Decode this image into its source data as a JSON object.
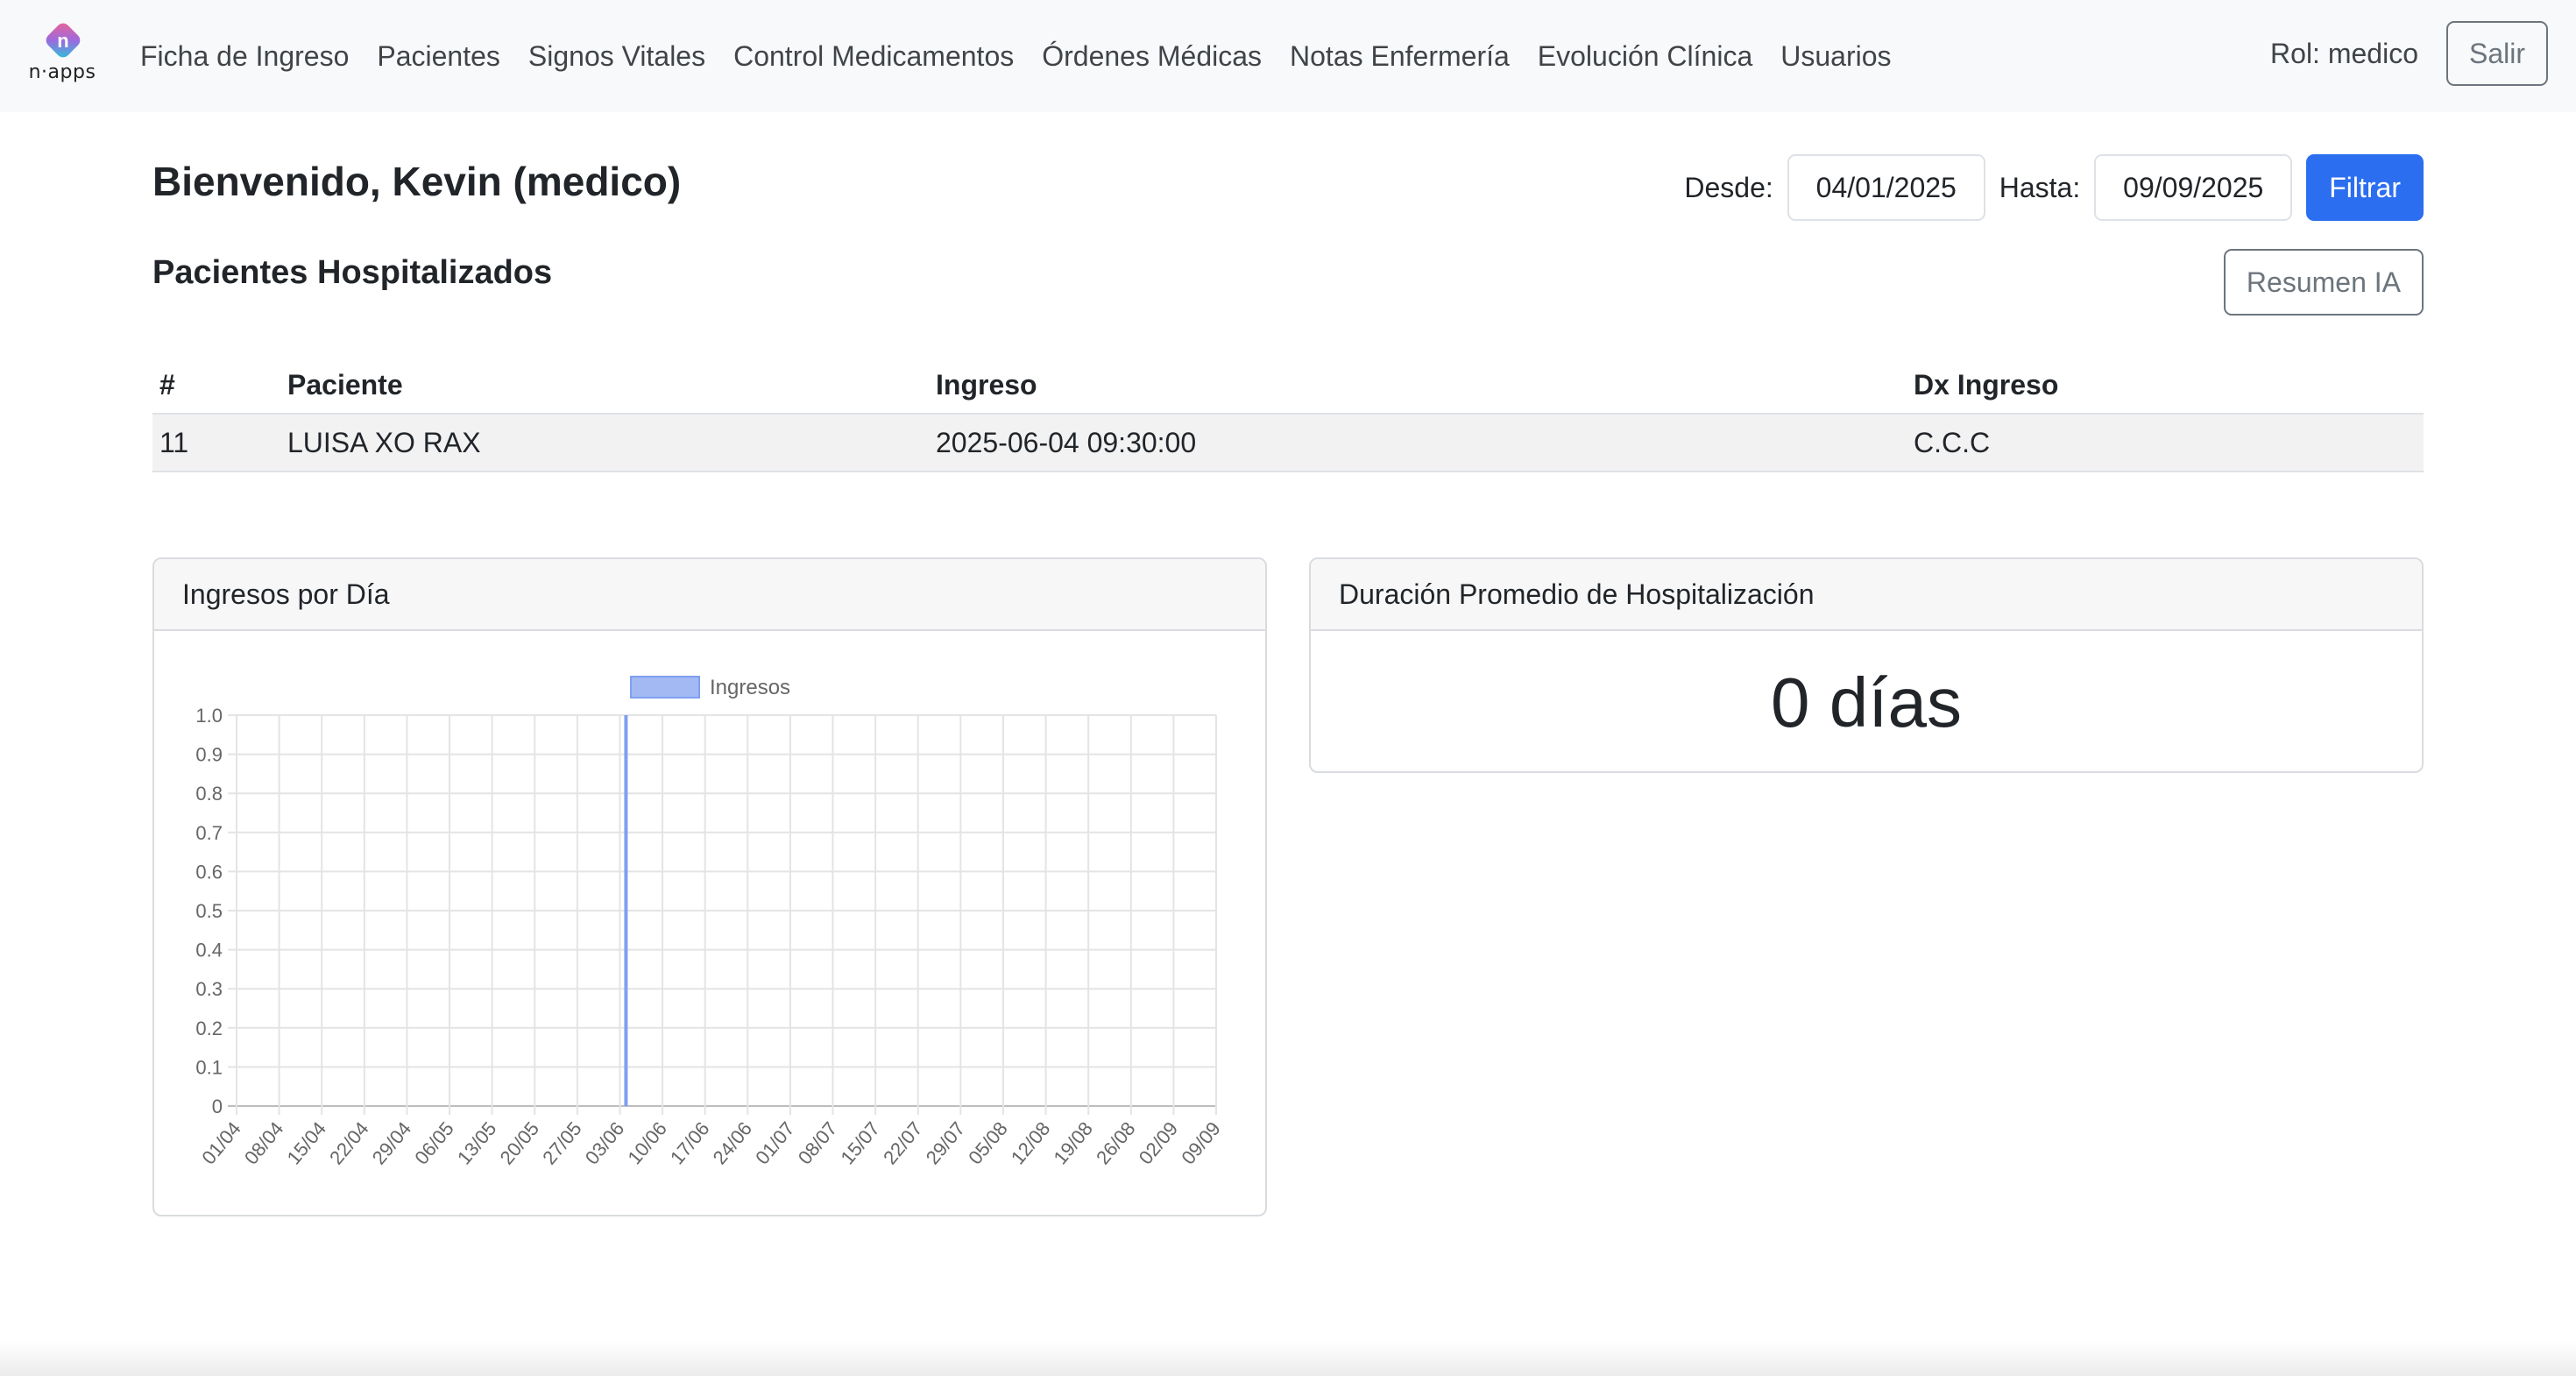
{
  "brand": {
    "logo_text": "n·apps",
    "logo_letter": "n"
  },
  "nav": {
    "items": [
      {
        "label": "Ficha de Ingreso"
      },
      {
        "label": "Pacientes"
      },
      {
        "label": "Signos Vitales"
      },
      {
        "label": "Control Medicamentos"
      },
      {
        "label": "Órdenes Médicas"
      },
      {
        "label": "Notas Enfermería"
      },
      {
        "label": "Evolución Clínica"
      },
      {
        "label": "Usuarios"
      }
    ],
    "role": "Rol: medico",
    "logout": "Salir"
  },
  "header": {
    "welcome": "Bienvenido, Kevin (medico)",
    "desde_label": "Desde:",
    "desde_value": "04/01/2025",
    "hasta_label": "Hasta:",
    "hasta_value": "09/09/2025",
    "filter_button": "Filtrar"
  },
  "section": {
    "title": "Pacientes Hospitalizados",
    "ai_button": "Resumen IA"
  },
  "table": {
    "columns": [
      "#",
      "Paciente",
      "Ingreso",
      "Dx Ingreso"
    ],
    "rows": [
      [
        "11",
        "LUISA XO RAX",
        "2025-06-04 09:30:00",
        "C.C.C"
      ]
    ]
  },
  "cards": {
    "chart_title": "Ingresos por Día",
    "duration_title": "Duración Promedio de Hospitalización",
    "duration_value": "0 días"
  },
  "colors": {
    "primary": "#2c6ef0",
    "bar": "#a3b9f4",
    "bar_border": "#7f9ff0"
  },
  "chart_data": {
    "type": "bar",
    "legend": [
      "Ingresos"
    ],
    "legend_position": "top",
    "x_tick_labels": [
      "01/04",
      "08/04",
      "15/04",
      "22/04",
      "29/04",
      "06/05",
      "13/05",
      "20/05",
      "27/05",
      "03/06",
      "10/06",
      "17/06",
      "24/06",
      "01/07",
      "08/07",
      "15/07",
      "22/07",
      "29/07",
      "05/08",
      "12/08",
      "19/08",
      "26/08",
      "02/09",
      "09/09"
    ],
    "x_range": [
      "01/04",
      "09/09"
    ],
    "series": [
      {
        "name": "Ingresos",
        "x": [
          "04/06"
        ],
        "values": [
          1
        ]
      }
    ],
    "ylim": [
      0,
      1
    ],
    "y_ticks": [
      "0",
      "0.1",
      "0.2",
      "0.3",
      "0.4",
      "0.5",
      "0.6",
      "0.7",
      "0.8",
      "0.9",
      "1.0"
    ],
    "grid": true
  }
}
